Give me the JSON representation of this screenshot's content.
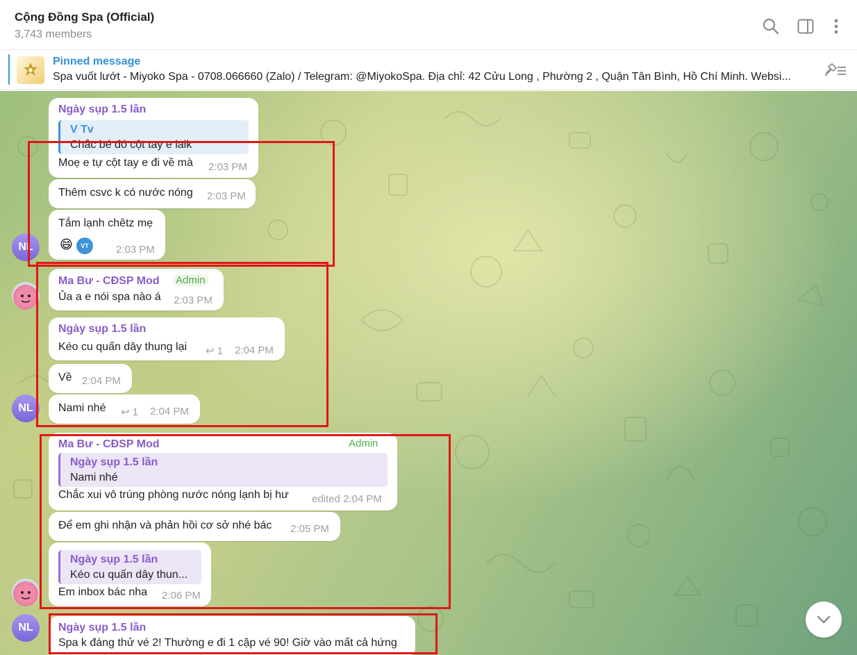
{
  "header": {
    "title": "Cộng Đồng Spa (Official)",
    "members": "3,743 members"
  },
  "pinned": {
    "label": "Pinned message",
    "text": "Spa vuốt lướt  - Miyoko Spa - 0708.066660 (Zalo) / Telegram: @MiyokoSpa.  Địa chỉ: 42 Cửu Long , Phường 2 , Quận Tân Bình, Hồ Chí Minh. Websi..."
  },
  "messages": [
    {
      "sender": "Ngày sụp 1.5 lần",
      "quote_name": "V Tv",
      "quote_text": "Chắc bé đó cột tay e laik",
      "text": "Moẹ e tự cột tay e đi về mà",
      "time": "2:03 PM"
    },
    {
      "text": "Thêm csvc k có nước nóng",
      "time": "2:03 PM"
    },
    {
      "text": "Tắm lạnh chêtz mẹ",
      "time": "2:03 PM",
      "reaction_emoji": "😄",
      "reaction_avatar": "VT"
    },
    {
      "sender": "Ma Bư - CĐSP Mod",
      "admin": "Admin",
      "text": "Ủa a e nói spa nào á",
      "time": "2:03 PM"
    },
    {
      "sender": "Ngày sụp 1.5 lần",
      "text": "Kéo cu quấn dây thung lại",
      "replies": "1",
      "time": "2:04 PM"
    },
    {
      "text": "Về",
      "time": "2:04 PM"
    },
    {
      "text": "Nami nhé",
      "replies": "1",
      "time": "2:04 PM"
    },
    {
      "sender": "Ma Bư - CĐSP Mod",
      "admin": "Admin",
      "quote_name": "Ngày sụp 1.5 lần",
      "quote_text": "Nami nhé",
      "text": "Chắc xui vô trúng phòng nước nóng lạnh bị hư",
      "time": "edited 2:04 PM"
    },
    {
      "text": "Để em ghi nhận và phản hồi cơ sở nhé bác",
      "time": "2:05 PM"
    },
    {
      "quote_name": "Ngày sụp 1.5 lần",
      "quote_text": "Kéo cu quấn dây thun...",
      "text": "Em inbox bác nha",
      "time": "2:06 PM"
    },
    {
      "sender": "Ngày sụp 1.5 lần",
      "text": "Spa k đáng thử vé 2! Thường e đi 1 cặp vé 90! Giờ vào mất cả hứng"
    }
  ],
  "avatars": {
    "nl_initials": "NL"
  },
  "icons": [
    "search-icon",
    "sidebar-toggle-icon",
    "more-vertical-icon",
    "unpin-icon",
    "chevron-down-icon"
  ],
  "colors": {
    "accent": "#3d94d6",
    "sender_name": "#8a5cc7",
    "admin": "#4fae4e",
    "highlight_box": "#e01616"
  }
}
